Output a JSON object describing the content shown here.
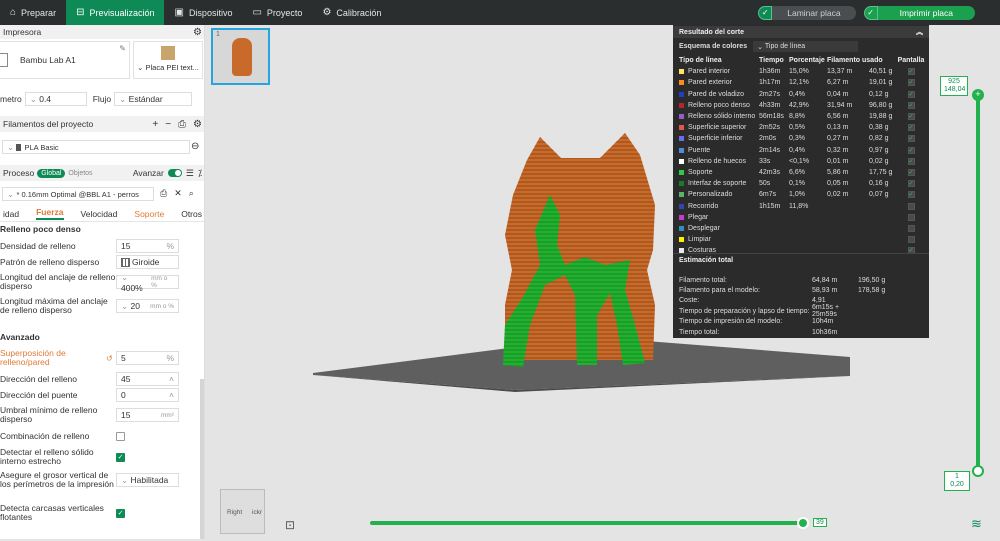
{
  "topbar": {
    "tabs": [
      {
        "label": "Preparar",
        "icon": "home-icon"
      },
      {
        "label": "Previsualización",
        "icon": "preview-icon",
        "active": true
      },
      {
        "label": "Dispositivo",
        "icon": "device-icon"
      },
      {
        "label": "Proyecto",
        "icon": "project-icon"
      },
      {
        "label": "Calibración",
        "icon": "calibration-icon"
      }
    ],
    "slice_label": "Laminar placa",
    "print_label": "Imprimir placa"
  },
  "left": {
    "printer_title": "Impresora",
    "printer_name": "Bambu Lab A1",
    "plate_name": "Placa PEI text...",
    "nozzle_label": "metro",
    "nozzle_value": "0.4",
    "flow_label": "Flujo",
    "flow_value": "Estándar",
    "filaments_title": "Filamentos del proyecto",
    "filament_name": "PLA Basic",
    "process_title": "Proceso",
    "process_global": "Global",
    "process_objects": "Objetos",
    "advanced_label": "Avanzar",
    "profile_name": "* 0.16mm Optimal @BBL A1 - perros",
    "tabs": [
      "idad",
      "Fuerza",
      "Velocidad",
      "Soporte",
      "Otros"
    ],
    "section_sparse": "Relleno poco denso",
    "settings": {
      "density_label": "Densidad de relleno",
      "density_value": "15",
      "density_unit": "%",
      "pattern_label": "Patrón de relleno disperso",
      "pattern_value": "Giroide",
      "anchor_label": "Longitud del anclaje de relleno disperso",
      "anchor_value": "400%",
      "anchor_unit": "mm o %",
      "anchor_max_label": "Longitud máxima del anclaje de relleno disperso",
      "anchor_max_value": "20",
      "anchor_max_unit": "mm o %",
      "advanced_section": "Avanzado",
      "overlap_label": "Superposición de relleno/pared",
      "overlap_value": "5",
      "overlap_unit": "%",
      "direction_label": "Dirección del relleno",
      "direction_value": "45",
      "bridge_label": "Dirección del puente",
      "bridge_value": "0",
      "threshold_label": "Umbral mínimo de relleno disperso",
      "threshold_value": "15",
      "threshold_unit": "mm²",
      "combine_label": "Combinación de relleno",
      "detect_label": "Detectar el relleno sólido interno estrecho",
      "ensure_label": "Asegure el grosor vertical de los perímetros de la impresión",
      "ensure_value": "Habilitada",
      "floating_label": "Detecta carcasas verticales flotantes"
    }
  },
  "panel": {
    "title": "Resultado del corte",
    "scheme_label": "Esquema de colores",
    "scheme_value": "Tipo de línea",
    "headers": [
      "Tipo de línea",
      "Tiempo",
      "Porcentaje",
      "Filamento usado",
      "",
      "Pantalla"
    ],
    "rows": [
      {
        "name": "Pared interior",
        "color": "#ffe566",
        "time": "1h36m",
        "pct": "15,0%",
        "m": "13,37 m",
        "g": "40,51 g",
        "show": true
      },
      {
        "name": "Pared exterior",
        "color": "#ff8c1a",
        "time": "1h17m",
        "pct": "12,1%",
        "m": "6,27 m",
        "g": "19,01 g",
        "show": true
      },
      {
        "name": "Pared de voladizo",
        "color": "#1f3fc7",
        "time": "2m27s",
        "pct": "0,4%",
        "m": "0,04 m",
        "g": "0,12 g",
        "show": true
      },
      {
        "name": "Relleno poco denso",
        "color": "#b3262e",
        "time": "4h33m",
        "pct": "42,9%",
        "m": "31,94 m",
        "g": "96,80 g",
        "show": true
      },
      {
        "name": "Relleno sólido interno",
        "color": "#9b59d0",
        "time": "56m18s",
        "pct": "8,8%",
        "m": "6,56 m",
        "g": "19,88 g",
        "show": true
      },
      {
        "name": "Superficie superior",
        "color": "#e2574c",
        "time": "2m52s",
        "pct": "0,5%",
        "m": "0,13 m",
        "g": "0,38 g",
        "show": true
      },
      {
        "name": "Superficie inferior",
        "color": "#6c6cf0",
        "time": "2m0s",
        "pct": "0,3%",
        "m": "0,27 m",
        "g": "0,82 g",
        "show": true
      },
      {
        "name": "Puente",
        "color": "#4d8fd6",
        "time": "2m14s",
        "pct": "0,4%",
        "m": "0,32 m",
        "g": "0,97 g",
        "show": true
      },
      {
        "name": "Relleno de huecos",
        "color": "#ffffff",
        "time": "33s",
        "pct": "<0,1%",
        "m": "0,01 m",
        "g": "0,02 g",
        "show": true
      },
      {
        "name": "Soporte",
        "color": "#2ecc40",
        "time": "42m3s",
        "pct": "6,6%",
        "m": "5,86 m",
        "g": "17,75 g",
        "show": true
      },
      {
        "name": "Interfaz de soporte",
        "color": "#1a7a2a",
        "time": "50s",
        "pct": "0,1%",
        "m": "0,05 m",
        "g": "0,16 g",
        "show": true
      },
      {
        "name": "Personalizado",
        "color": "#5ab56a",
        "time": "6m7s",
        "pct": "1,0%",
        "m": "0,02 m",
        "g": "0,07 g",
        "show": true
      },
      {
        "name": "Recorrido",
        "color": "#3344aa",
        "time": "1h15m",
        "pct": "11,8%",
        "m": "",
        "g": "",
        "show": false
      },
      {
        "name": "Plegar",
        "color": "#c73ad6",
        "time": "",
        "pct": "",
        "m": "",
        "g": "",
        "show": false
      },
      {
        "name": "Desplegar",
        "color": "#2f8fbf",
        "time": "",
        "pct": "",
        "m": "",
        "g": "",
        "show": false
      },
      {
        "name": "Limpiar",
        "color": "#ffee00",
        "time": "",
        "pct": "",
        "m": "",
        "g": "",
        "show": false
      },
      {
        "name": "Costuras",
        "color": "#e8e8e8",
        "time": "",
        "pct": "",
        "m": "",
        "g": "",
        "show": true
      }
    ],
    "estimate_title": "Estimación total",
    "estimates": [
      {
        "label": "Filamento total:",
        "m": "64,84 m",
        "g": "196,50 g"
      },
      {
        "label": "Filamento para el modelo:",
        "m": "58,93 m",
        "g": "178,58 g"
      },
      {
        "label": "Coste:",
        "m": "4,91",
        "g": ""
      },
      {
        "label": "Tiempo de preparación y lapso de tiempo:",
        "m": "6m15s + 25m59s",
        "g": ""
      },
      {
        "label": "Tiempo de impresión del modelo:",
        "m": "10h4m",
        "g": ""
      },
      {
        "label": "Tiempo total:",
        "m": "10h36m",
        "g": ""
      }
    ]
  },
  "layers": {
    "top_layer": "925",
    "top_height": "148,04",
    "bottom_layer": "1",
    "bottom_height": "0,20",
    "moves_value": "39"
  },
  "viewcube": {
    "right": "Right",
    "back": "ickr"
  },
  "thumb": {
    "index": "1"
  }
}
